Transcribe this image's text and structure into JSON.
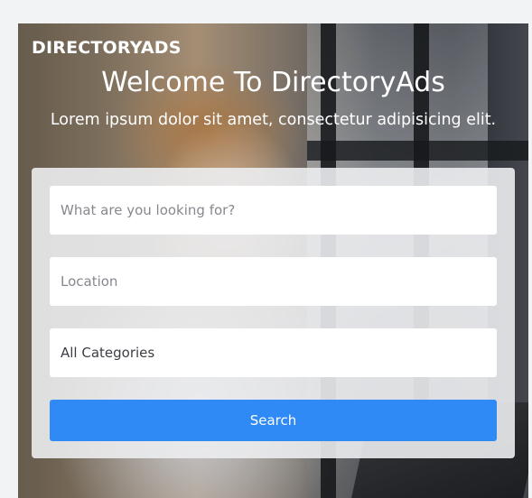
{
  "brand": {
    "name": "DIRECTORYADS"
  },
  "hero": {
    "title": "Welcome To DirectoryAds",
    "subtitle": "Lorem ipsum dolor sit amet, consectetur adipisicing elit."
  },
  "search": {
    "keyword_placeholder": "What are you looking for?",
    "location_placeholder": "Location",
    "category_selected": "All Categories",
    "button_label": "Search"
  },
  "colors": {
    "accent": "#2f8af5",
    "panel": "#ecedf0",
    "text_light": "#ffffff"
  }
}
